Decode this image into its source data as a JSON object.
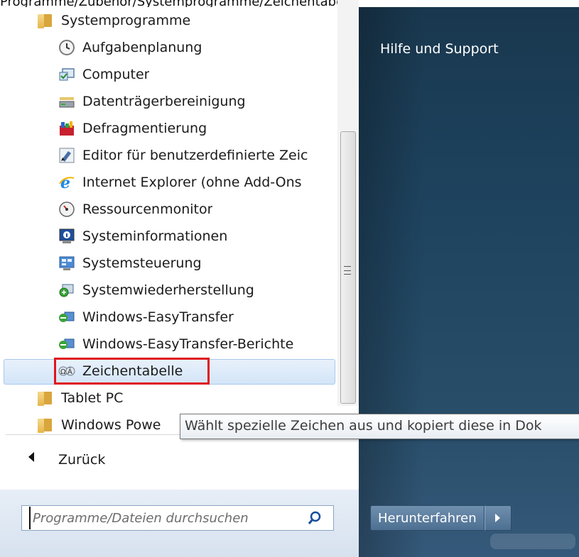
{
  "breadcrumb": "Programme/Zubehör/Systemprogramme/Zeichentabelle",
  "programs": [
    {
      "label": "Systemprogramme",
      "icon": "folder-icon",
      "type": "folder"
    },
    {
      "label": "Aufgabenplanung",
      "icon": "clock-icon",
      "type": "app"
    },
    {
      "label": "Computer",
      "icon": "computer-icon",
      "type": "app"
    },
    {
      "label": "Datenträgerbereinigung",
      "icon": "disk-cleanup-icon",
      "type": "app"
    },
    {
      "label": "Defragmentierung",
      "icon": "defrag-icon",
      "type": "app"
    },
    {
      "label": "Editor für benutzerdefinierte Zeic",
      "icon": "character-editor-icon",
      "type": "app"
    },
    {
      "label": "Internet Explorer (ohne Add-Ons",
      "icon": "internet-explorer-icon",
      "type": "app"
    },
    {
      "label": "Ressourcenmonitor",
      "icon": "resource-monitor-icon",
      "type": "app"
    },
    {
      "label": "Systeminformationen",
      "icon": "system-info-icon",
      "type": "app"
    },
    {
      "label": "Systemsteuerung",
      "icon": "control-panel-icon",
      "type": "app"
    },
    {
      "label": "Systemwiederherstellung",
      "icon": "system-restore-icon",
      "type": "app"
    },
    {
      "label": "Windows-EasyTransfer",
      "icon": "easy-transfer-icon",
      "type": "app"
    },
    {
      "label": "Windows-EasyTransfer-Berichte",
      "icon": "easy-transfer-reports-icon",
      "type": "app"
    },
    {
      "label": "Zeichentabelle",
      "icon": "character-map-icon",
      "type": "app",
      "selected": true
    },
    {
      "label": "Tablet PC",
      "icon": "folder-icon",
      "type": "folder"
    },
    {
      "label": "Windows Powe",
      "icon": "folder-icon",
      "type": "folder"
    }
  ],
  "back_label": "Zurück",
  "search": {
    "placeholder": "Programme/Dateien durchsuchen"
  },
  "right": {
    "help_label": "Hilfe und Support"
  },
  "shutdown_label": "Herunterfahren",
  "tooltip": "Wählt spezielle Zeichen aus und kopiert diese in Dok",
  "colors": {
    "highlight_border": "#e0161b",
    "right_panel": "#1f4460",
    "selection": "#d3e5f8"
  }
}
